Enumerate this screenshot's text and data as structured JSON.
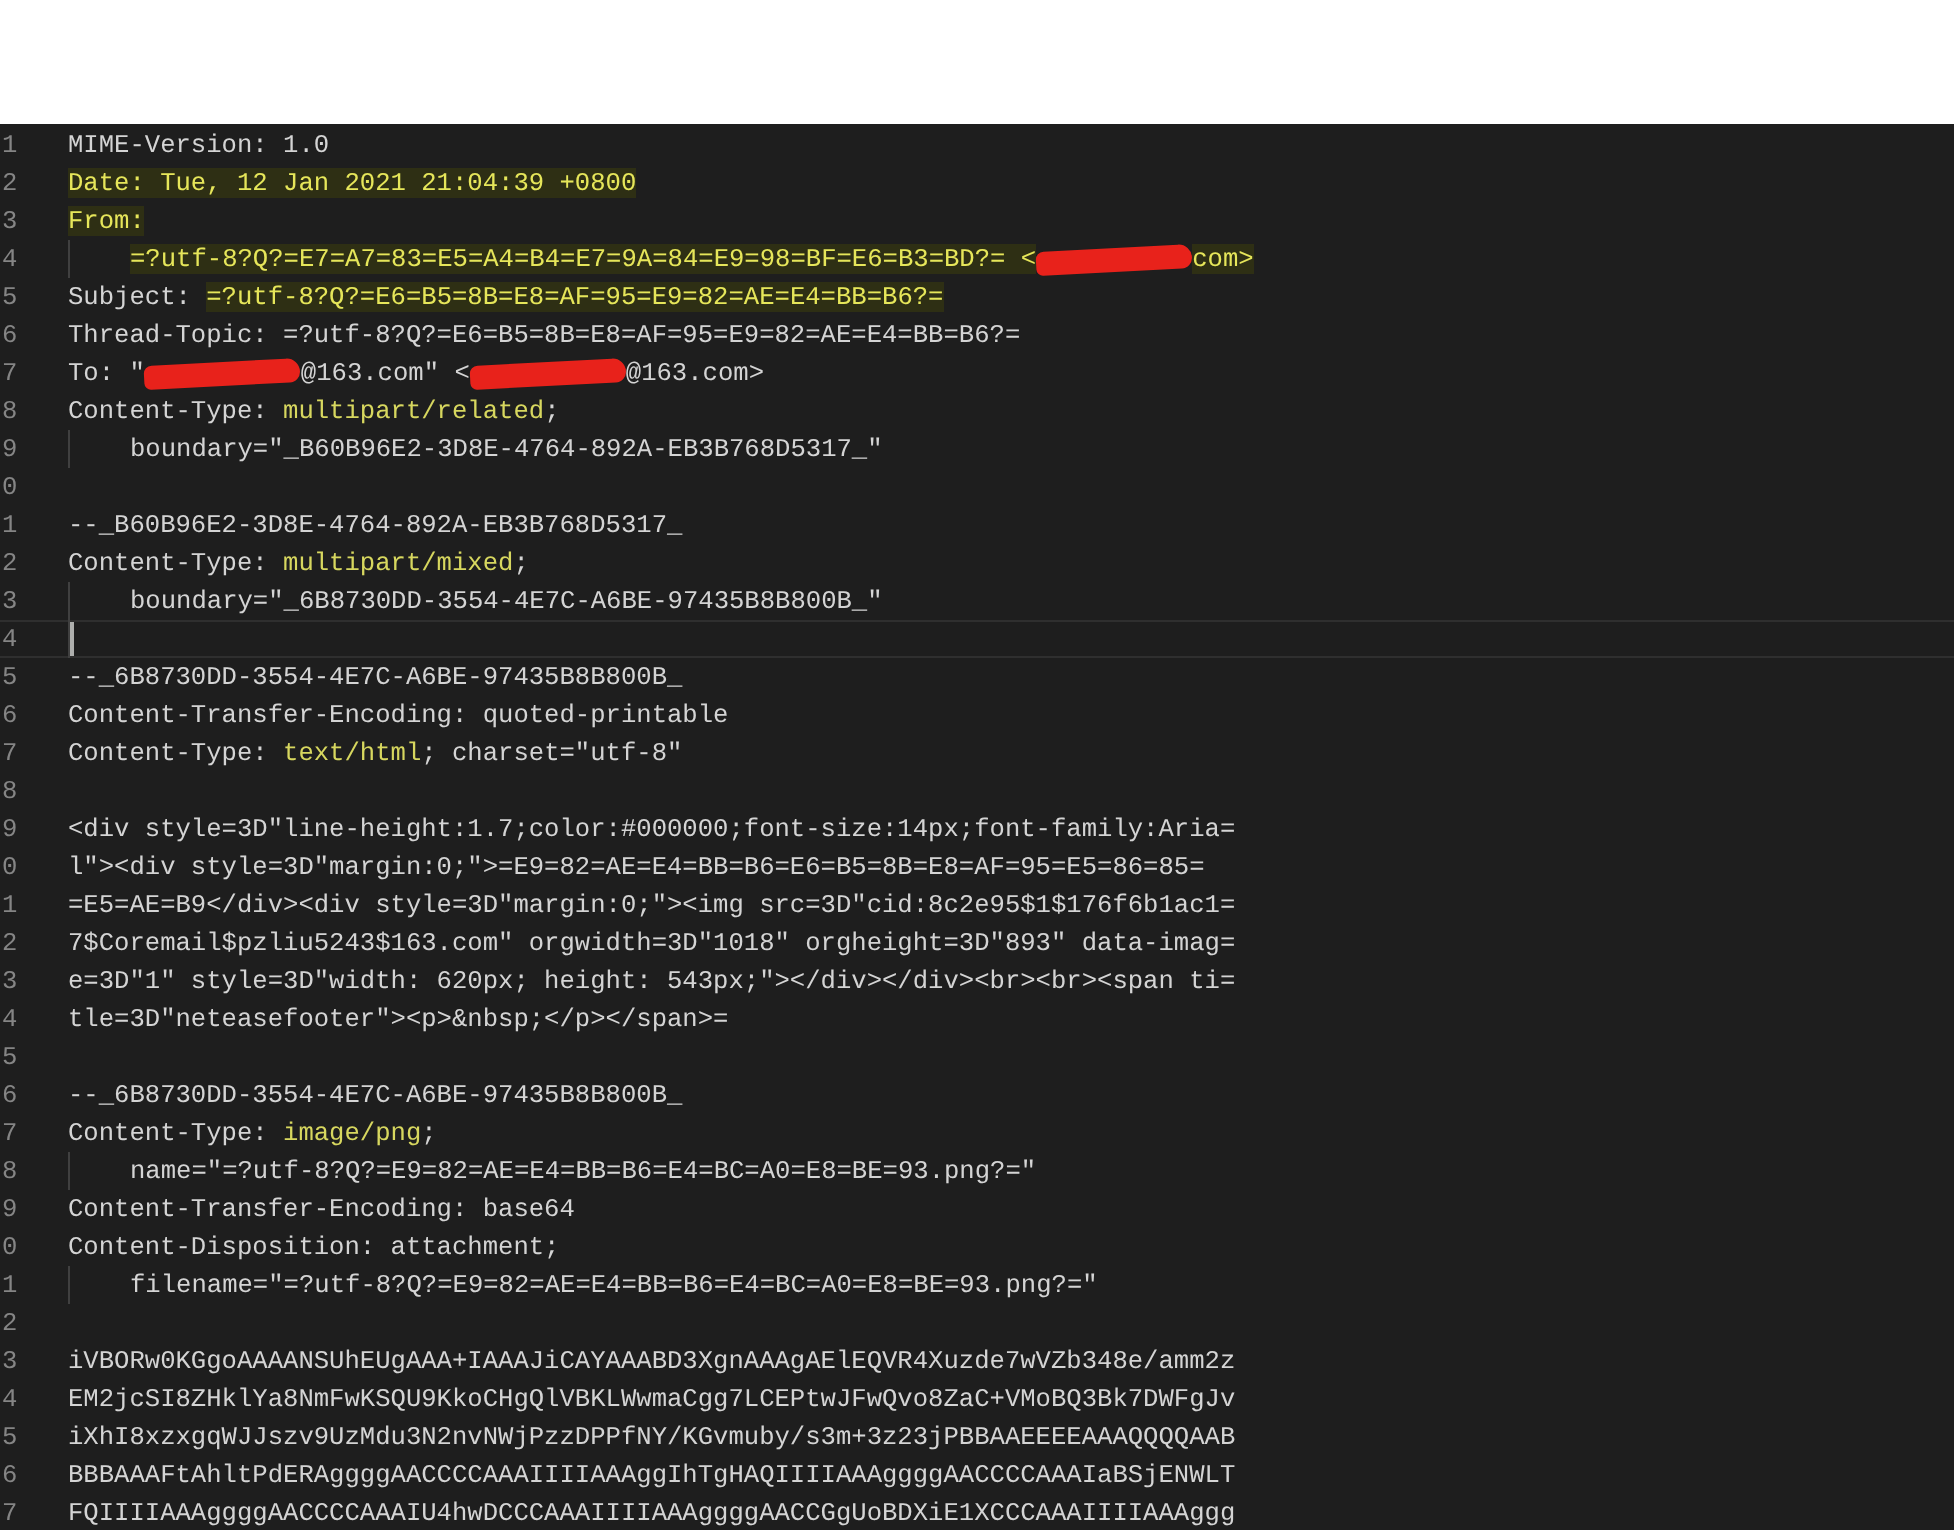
{
  "editor": {
    "lines": [
      {
        "number": "1",
        "segments": [
          {
            "kind": "plain",
            "text": "MIME-Version: 1.0"
          }
        ]
      },
      {
        "number": "2",
        "segments": [
          {
            "kind": "match",
            "text": "Date: Tue, 12 Jan 2021 21:04:39 +0800"
          }
        ]
      },
      {
        "number": "3",
        "segments": [
          {
            "kind": "match",
            "text": "From:"
          }
        ]
      },
      {
        "number": "4",
        "indent": true,
        "segments": [
          {
            "kind": "match",
            "text": "=?utf-8?Q?=E7=A7=83=E5=A4=B4=E7=9A=84=E9=98=BF=E6=B3=BD?= <"
          },
          {
            "kind": "redaction"
          },
          {
            "kind": "match",
            "text": "com>"
          }
        ]
      },
      {
        "number": "5",
        "segments": [
          {
            "kind": "plain",
            "text": "Subject: "
          },
          {
            "kind": "match",
            "text": "=?utf-8?Q?=E6=B5=8B=E8=AF=95=E9=82=AE=E4=BB=B6?="
          }
        ]
      },
      {
        "number": "6",
        "segments": [
          {
            "kind": "plain",
            "text": "Thread-Topic: =?utf-8?Q?=E6=B5=8B=E8=AF=95=E9=82=AE=E4=BB=B6?="
          }
        ]
      },
      {
        "number": "7",
        "segments": [
          {
            "kind": "plain",
            "text": "To: \""
          },
          {
            "kind": "redaction"
          },
          {
            "kind": "plain",
            "text": "@163.com\" <"
          },
          {
            "kind": "redaction"
          },
          {
            "kind": "plain",
            "text": "@163.com>"
          }
        ]
      },
      {
        "number": "8",
        "segments": [
          {
            "kind": "plain",
            "text": "Content-Type: "
          },
          {
            "kind": "keyword",
            "text": "multipart/related"
          },
          {
            "kind": "plain",
            "text": ";"
          }
        ]
      },
      {
        "number": "9",
        "indent": true,
        "segments": [
          {
            "kind": "plain",
            "text": "boundary=\"_B60B96E2-3D8E-4764-892A-EB3B768D5317_\""
          }
        ]
      },
      {
        "number": "0"
      },
      {
        "number": "1",
        "segments": [
          {
            "kind": "plain",
            "text": "--_B60B96E2-3D8E-4764-892A-EB3B768D5317_"
          }
        ]
      },
      {
        "number": "2",
        "segments": [
          {
            "kind": "plain",
            "text": "Content-Type: "
          },
          {
            "kind": "keyword",
            "text": "multipart/mixed"
          },
          {
            "kind": "plain",
            "text": ";"
          }
        ]
      },
      {
        "number": "3",
        "indent": true,
        "segments": [
          {
            "kind": "plain",
            "text": "boundary=\"_6B8730DD-3554-4E7C-A6BE-97435B8B800B_\""
          }
        ]
      },
      {
        "number": "4",
        "indent": true,
        "current": true
      },
      {
        "number": "5",
        "segments": [
          {
            "kind": "plain",
            "text": "--_6B8730DD-3554-4E7C-A6BE-97435B8B800B_"
          }
        ]
      },
      {
        "number": "6",
        "segments": [
          {
            "kind": "plain",
            "text": "Content-Transfer-Encoding: quoted-printable"
          }
        ]
      },
      {
        "number": "7",
        "segments": [
          {
            "kind": "plain",
            "text": "Content-Type: "
          },
          {
            "kind": "keyword",
            "text": "text/html"
          },
          {
            "kind": "plain",
            "text": "; charset=\"utf-8\""
          }
        ]
      },
      {
        "number": "8"
      },
      {
        "number": "9",
        "segments": [
          {
            "kind": "plain",
            "text": "<div style=3D\"line-height:1.7;color:#000000;font-size:14px;font-family:Aria="
          }
        ]
      },
      {
        "number": "0",
        "segments": [
          {
            "kind": "plain",
            "text": "l\"><div style=3D\"margin:0;\">=E9=82=AE=E4=BB=B6=E6=B5=8B=E8=AF=95=E5=86=85="
          }
        ]
      },
      {
        "number": "1",
        "segments": [
          {
            "kind": "plain",
            "text": "=E5=AE=B9</div><div style=3D\"margin:0;\"><img src=3D\"cid:8c2e95$1$176f6b1ac1="
          }
        ]
      },
      {
        "number": "2",
        "segments": [
          {
            "kind": "plain",
            "text": "7$Coremail$pzliu5243$163.com\" orgwidth=3D\"1018\" orgheight=3D\"893\" data-imag="
          }
        ]
      },
      {
        "number": "3",
        "segments": [
          {
            "kind": "plain",
            "text": "e=3D\"1\" style=3D\"width: 620px; height: 543px;\"></div></div><br><br><span ti="
          }
        ]
      },
      {
        "number": "4",
        "segments": [
          {
            "kind": "plain",
            "text": "tle=3D\"neteasefooter\"><p>&nbsp;</p></span>="
          }
        ]
      },
      {
        "number": "5"
      },
      {
        "number": "6",
        "segments": [
          {
            "kind": "plain",
            "text": "--_6B8730DD-3554-4E7C-A6BE-97435B8B800B_"
          }
        ]
      },
      {
        "number": "7",
        "segments": [
          {
            "kind": "plain",
            "text": "Content-Type: "
          },
          {
            "kind": "keyword",
            "text": "image/png"
          },
          {
            "kind": "plain",
            "text": ";"
          }
        ]
      },
      {
        "number": "8",
        "indent": true,
        "segments": [
          {
            "kind": "plain",
            "text": "name=\"=?utf-8?Q?=E9=82=AE=E4=BB=B6=E4=BC=A0=E8=BE=93.png?=\""
          }
        ]
      },
      {
        "number": "9",
        "segments": [
          {
            "kind": "plain",
            "text": "Content-Transfer-Encoding: base64"
          }
        ]
      },
      {
        "number": "0",
        "segments": [
          {
            "kind": "plain",
            "text": "Content-Disposition: attachment;"
          }
        ]
      },
      {
        "number": "1",
        "indent": true,
        "segments": [
          {
            "kind": "plain",
            "text": "filename=\"=?utf-8?Q?=E9=82=AE=E4=BB=B6=E4=BC=A0=E8=BE=93.png?=\""
          }
        ]
      },
      {
        "number": "2"
      },
      {
        "number": "3",
        "segments": [
          {
            "kind": "plain",
            "text": "iVBORw0KGgoAAAANSUhEUgAAA+IAAAJiCAYAAABD3XgnAAAgAElEQVR4Xuzde7wVZb348e/amm2z"
          }
        ]
      },
      {
        "number": "4",
        "segments": [
          {
            "kind": "plain",
            "text": "EM2jcSI8ZHklYa8NmFwKSQU9KkoCHgQlVBKLWwmaCgg7LCEPtwJFwQvo8ZaC+VMoBQ3Bk7DWFgJv"
          }
        ]
      },
      {
        "number": "5",
        "segments": [
          {
            "kind": "plain",
            "text": "iXhI8xzxgqWJJszv9UzMdu3N2nvNWjPzzDPPfNY/KGvmuby/s3m+3z23jPBBAAEEEEAAAQQQQAAB"
          }
        ]
      },
      {
        "number": "6",
        "segments": [
          {
            "kind": "plain",
            "text": "BBBAAAFtAhltPdERAggggAACCCCAAAIIIIAAAggIhTgHAQIIIIAAAggggAACCCCAAAIaBSjENWLT"
          }
        ]
      },
      {
        "number": "7",
        "segments": [
          {
            "kind": "plain",
            "text": "FQIIIIAAAggggAACCCCAAAIU4hwDCCCAAAIIIIAAAggggAACCGgUoBDXiE1XCCCAAAIIIIAAAggg"
          }
        ]
      }
    ]
  }
}
